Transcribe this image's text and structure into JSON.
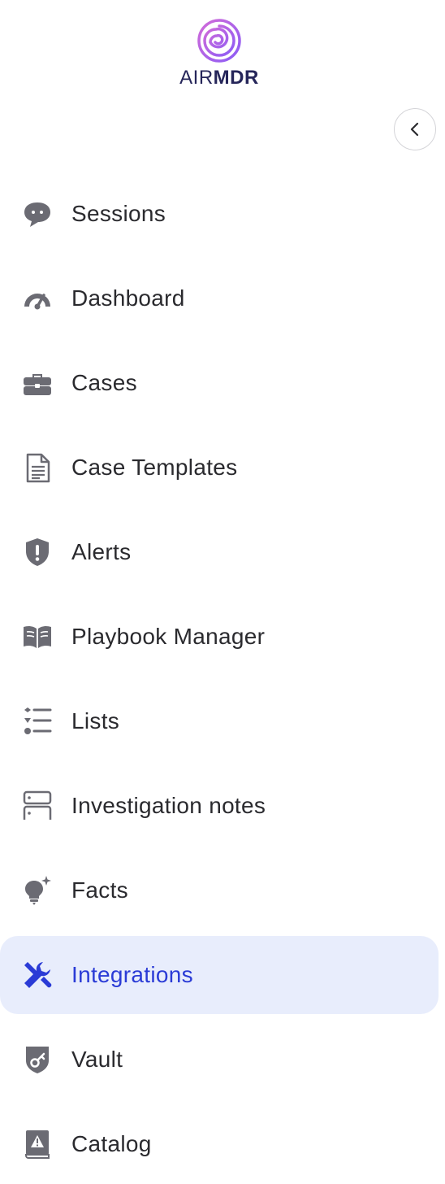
{
  "logo": {
    "word_air": "AIR",
    "word_mdr": "MDR"
  },
  "collapse_button": {
    "icon": "chevron-left-icon"
  },
  "nav": {
    "items": [
      {
        "label": "Sessions",
        "icon": "chat-bubble-icon",
        "active": false
      },
      {
        "label": "Dashboard",
        "icon": "speedometer-icon",
        "active": false
      },
      {
        "label": "Cases",
        "icon": "briefcase-icon",
        "active": false
      },
      {
        "label": "Case Templates",
        "icon": "document-icon",
        "active": false
      },
      {
        "label": "Alerts",
        "icon": "shield-alert-icon",
        "active": false
      },
      {
        "label": "Playbook Manager",
        "icon": "open-book-icon",
        "active": false
      },
      {
        "label": "Lists",
        "icon": "list-icon",
        "active": false
      },
      {
        "label": "Investigation notes",
        "icon": "server-stack-icon",
        "active": false
      },
      {
        "label": "Facts",
        "icon": "lightbulb-sparkle-icon",
        "active": false
      },
      {
        "label": "Integrations",
        "icon": "tools-icon",
        "active": true
      },
      {
        "label": "Vault",
        "icon": "shield-key-icon",
        "active": false
      },
      {
        "label": "Catalog",
        "icon": "catalog-book-icon",
        "active": false
      }
    ]
  },
  "colors": {
    "icon_gray": "#6b6b73",
    "active_blue": "#2a3bd6",
    "active_bg": "#e8edfc",
    "text": "#2a2a2e"
  }
}
